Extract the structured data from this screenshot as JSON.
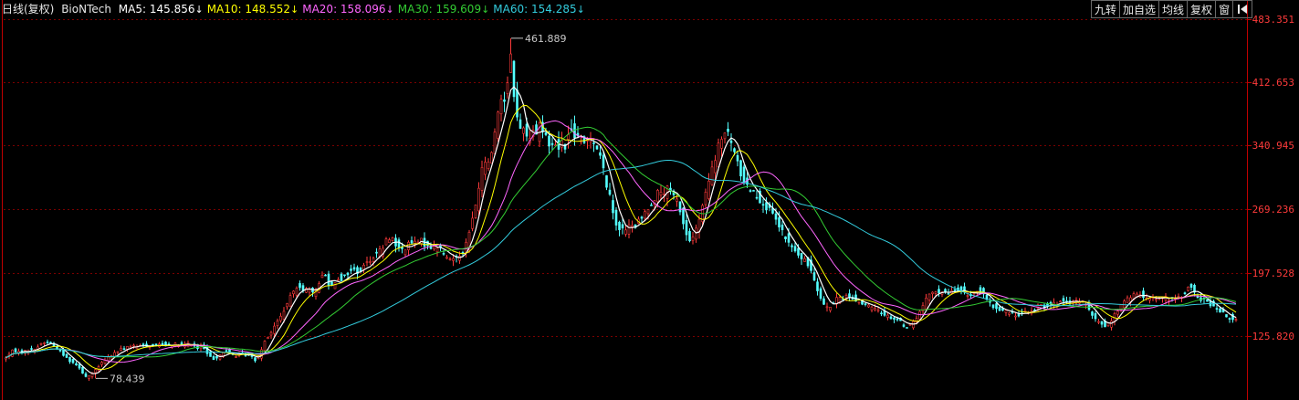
{
  "legend": {
    "title": "日线(复权)",
    "symbol": "BioNTech",
    "items": [
      {
        "label": "MA5:",
        "value": "145.856",
        "arrow": "↓",
        "color": "#ffffff"
      },
      {
        "label": "MA10:",
        "value": "148.552",
        "arrow": "↓",
        "color": "#ffff00"
      },
      {
        "label": "MA20:",
        "value": "158.096",
        "arrow": "↓",
        "color": "#ff66ff"
      },
      {
        "label": "MA30:",
        "value": "159.609",
        "arrow": "↓",
        "color": "#33cc33"
      },
      {
        "label": "MA60:",
        "value": "154.285",
        "arrow": "↓",
        "color": "#33ccdd"
      }
    ]
  },
  "toolbar": {
    "buttons": [
      "九转",
      "加自选",
      "均线",
      "复权",
      "窗"
    ],
    "icon": "collapse-left-icon"
  },
  "colors": {
    "up": "#ff3b3b",
    "down": "#54ffff",
    "grid": "#7a0000",
    "axis": "#c00000",
    "label": "#ff3b3b",
    "annotation": "#c8c8c8"
  },
  "chart_data": {
    "type": "candlestick",
    "y_ticks": [
      "483.351",
      "412.653",
      "340.945",
      "269.236",
      "197.528",
      "125.820"
    ],
    "ylim": [
      54.1,
      483.351
    ],
    "annotations": [
      {
        "text": "461.889",
        "value": 461.889,
        "type": "high"
      },
      {
        "text": "78.439",
        "value": 78.439,
        "type": "low"
      }
    ],
    "series": [
      {
        "name": "MA5",
        "color": "#ffffff",
        "width": 1.2
      },
      {
        "name": "MA10",
        "color": "#ffff00",
        "width": 1
      },
      {
        "name": "MA20",
        "color": "#ff66ff",
        "width": 1
      },
      {
        "name": "MA30",
        "color": "#33cc33",
        "width": 1
      },
      {
        "name": "MA60",
        "color": "#33ccdd",
        "width": 1
      }
    ],
    "close_path": [
      [
        0,
        98
      ],
      [
        7,
        103
      ],
      [
        14,
        110
      ],
      [
        22,
        108
      ],
      [
        30,
        110
      ],
      [
        38,
        112
      ],
      [
        45,
        118
      ],
      [
        52,
        120
      ],
      [
        58,
        115
      ],
      [
        63,
        112
      ],
      [
        68,
        106
      ],
      [
        74,
        100
      ],
      [
        80,
        96
      ],
      [
        86,
        92
      ],
      [
        90,
        85
      ],
      [
        94,
        80
      ],
      [
        98,
        82
      ],
      [
        103,
        86
      ],
      [
        110,
        95
      ],
      [
        118,
        102
      ],
      [
        126,
        108
      ],
      [
        134,
        112
      ],
      [
        142,
        115
      ],
      [
        150,
        114
      ],
      [
        158,
        116
      ],
      [
        166,
        115
      ],
      [
        174,
        117
      ],
      [
        182,
        116
      ],
      [
        190,
        117
      ],
      [
        198,
        115
      ],
      [
        206,
        118
      ],
      [
        212,
        115
      ],
      [
        216,
        112
      ],
      [
        220,
        116
      ],
      [
        224,
        110
      ],
      [
        228,
        104
      ],
      [
        232,
        100
      ],
      [
        236,
        102
      ],
      [
        240,
        105
      ],
      [
        246,
        110
      ],
      [
        252,
        106
      ],
      [
        258,
        104
      ],
      [
        264,
        106
      ],
      [
        270,
        105
      ],
      [
        276,
        102
      ],
      [
        281,
        98
      ],
      [
        285,
        110
      ],
      [
        290,
        122
      ],
      [
        296,
        130
      ],
      [
        302,
        140
      ],
      [
        308,
        150
      ],
      [
        314,
        162
      ],
      [
        320,
        175
      ],
      [
        326,
        185
      ],
      [
        332,
        178
      ],
      [
        337,
        180
      ],
      [
        341,
        172
      ],
      [
        346,
        180
      ],
      [
        350,
        190
      ],
      [
        355,
        198
      ],
      [
        358,
        188
      ],
      [
        362,
        182
      ],
      [
        366,
        188
      ],
      [
        370,
        192
      ],
      [
        374,
        190
      ],
      [
        378,
        195
      ],
      [
        382,
        198
      ],
      [
        386,
        202
      ],
      [
        390,
        198
      ],
      [
        394,
        200
      ],
      [
        398,
        205
      ],
      [
        402,
        210
      ],
      [
        406,
        213
      ],
      [
        410,
        218
      ],
      [
        414,
        220
      ],
      [
        418,
        225
      ],
      [
        422,
        232
      ],
      [
        426,
        238
      ],
      [
        430,
        235
      ],
      [
        434,
        228
      ],
      [
        438,
        222
      ],
      [
        442,
        225
      ],
      [
        446,
        228
      ],
      [
        450,
        232
      ],
      [
        455,
        230
      ],
      [
        460,
        234
      ],
      [
        465,
        230
      ],
      [
        470,
        228
      ],
      [
        475,
        225
      ],
      [
        480,
        228
      ],
      [
        485,
        220
      ],
      [
        490,
        212
      ],
      [
        495,
        214
      ],
      [
        500,
        216
      ],
      [
        505,
        220
      ],
      [
        510,
        230
      ],
      [
        514,
        245
      ],
      [
        518,
        262
      ],
      [
        522,
        282
      ],
      [
        526,
        305
      ],
      [
        530,
        325
      ],
      [
        534,
        318
      ],
      [
        538,
        335
      ],
      [
        542,
        360
      ],
      [
        546,
        385
      ],
      [
        550,
        400
      ],
      [
        553,
        390
      ],
      [
        556,
        420
      ],
      [
        558,
        455
      ],
      [
        560,
        430
      ],
      [
        563,
        395
      ],
      [
        566,
        370
      ],
      [
        569,
        358
      ],
      [
        572,
        372
      ],
      [
        575,
        352
      ],
      [
        578,
        345
      ],
      [
        581,
        358
      ],
      [
        584,
        362
      ],
      [
        587,
        355
      ],
      [
        590,
        368
      ],
      [
        593,
        360
      ],
      [
        596,
        352
      ],
      [
        599,
        348
      ],
      [
        602,
        340
      ],
      [
        606,
        345
      ],
      [
        610,
        338
      ],
      [
        614,
        346
      ],
      [
        618,
        340
      ],
      [
        622,
        352
      ],
      [
        626,
        358
      ],
      [
        630,
        352
      ],
      [
        634,
        346
      ],
      [
        638,
        340
      ],
      [
        642,
        348
      ],
      [
        646,
        352
      ],
      [
        650,
        345
      ],
      [
        654,
        338
      ],
      [
        658,
        325
      ],
      [
        662,
        305
      ],
      [
        666,
        290
      ],
      [
        670,
        270
      ],
      [
        674,
        255
      ],
      [
        678,
        248
      ],
      [
        682,
        245
      ],
      [
        686,
        248
      ],
      [
        690,
        250
      ],
      [
        694,
        248
      ],
      [
        698,
        254
      ],
      [
        702,
        258
      ],
      [
        706,
        265
      ],
      [
        710,
        272
      ],
      [
        714,
        278
      ],
      [
        718,
        284
      ],
      [
        722,
        290
      ],
      [
        726,
        286
      ],
      [
        730,
        292
      ],
      [
        734,
        288
      ],
      [
        738,
        282
      ],
      [
        742,
        278
      ],
      [
        746,
        262
      ],
      [
        750,
        245
      ],
      [
        754,
        232
      ],
      [
        758,
        238
      ],
      [
        762,
        245
      ],
      [
        766,
        260
      ],
      [
        770,
        275
      ],
      [
        774,
        292
      ],
      [
        778,
        310
      ],
      [
        782,
        320
      ],
      [
        786,
        338
      ],
      [
        790,
        350
      ],
      [
        794,
        355
      ],
      [
        798,
        352
      ],
      [
        802,
        340
      ],
      [
        806,
        325
      ],
      [
        810,
        312
      ],
      [
        814,
        302
      ],
      [
        818,
        296
      ],
      [
        822,
        292
      ],
      [
        826,
        288
      ],
      [
        830,
        282
      ],
      [
        834,
        278
      ],
      [
        838,
        272
      ],
      [
        842,
        268
      ],
      [
        846,
        262
      ],
      [
        850,
        255
      ],
      [
        854,
        248
      ],
      [
        858,
        240
      ],
      [
        862,
        232
      ],
      [
        866,
        228
      ],
      [
        870,
        222
      ],
      [
        874,
        218
      ],
      [
        878,
        212
      ],
      [
        882,
        210
      ],
      [
        886,
        205
      ],
      [
        890,
        196
      ],
      [
        894,
        182
      ],
      [
        898,
        172
      ],
      [
        902,
        162
      ],
      [
        906,
        158
      ],
      [
        910,
        160
      ],
      [
        914,
        165
      ],
      [
        918,
        170
      ],
      [
        922,
        168
      ],
      [
        926,
        172
      ],
      [
        930,
        170
      ],
      [
        934,
        168
      ],
      [
        938,
        166
      ],
      [
        942,
        164
      ],
      [
        946,
        162
      ],
      [
        950,
        160
      ],
      [
        954,
        158
      ],
      [
        958,
        156
      ],
      [
        962,
        155
      ],
      [
        966,
        152
      ],
      [
        970,
        150
      ],
      [
        974,
        148
      ],
      [
        978,
        146
      ],
      [
        982,
        145
      ],
      [
        986,
        142
      ],
      [
        990,
        138
      ],
      [
        994,
        136
      ],
      [
        998,
        140
      ],
      [
        1002,
        145
      ],
      [
        1006,
        150
      ],
      [
        1010,
        160
      ],
      [
        1014,
        168
      ],
      [
        1018,
        172
      ],
      [
        1022,
        175
      ],
      [
        1026,
        176
      ],
      [
        1030,
        178
      ],
      [
        1034,
        175
      ],
      [
        1038,
        174
      ],
      [
        1042,
        176
      ],
      [
        1046,
        178
      ],
      [
        1050,
        180
      ],
      [
        1054,
        176
      ],
      [
        1058,
        174
      ],
      [
        1062,
        172
      ],
      [
        1066,
        175
      ],
      [
        1070,
        178
      ],
      [
        1074,
        176
      ],
      [
        1078,
        170
      ],
      [
        1082,
        165
      ],
      [
        1086,
        160
      ],
      [
        1090,
        158
      ],
      [
        1094,
        156
      ],
      [
        1098,
        155
      ],
      [
        1102,
        154
      ],
      [
        1106,
        152
      ],
      [
        1110,
        150
      ],
      [
        1114,
        150
      ],
      [
        1118,
        152
      ],
      [
        1122,
        154
      ],
      [
        1126,
        152
      ],
      [
        1130,
        154
      ],
      [
        1134,
        158
      ],
      [
        1138,
        162
      ],
      [
        1142,
        160
      ],
      [
        1146,
        162
      ],
      [
        1150,
        164
      ],
      [
        1154,
        162
      ],
      [
        1158,
        163
      ],
      [
        1162,
        165
      ],
      [
        1166,
        164
      ],
      [
        1170,
        162
      ],
      [
        1174,
        164
      ],
      [
        1178,
        165
      ],
      [
        1182,
        166
      ],
      [
        1186,
        164
      ],
      [
        1190,
        160
      ],
      [
        1194,
        152
      ],
      [
        1198,
        146
      ],
      [
        1202,
        142
      ],
      [
        1206,
        140
      ],
      [
        1210,
        138
      ],
      [
        1214,
        140
      ],
      [
        1218,
        146
      ],
      [
        1222,
        152
      ],
      [
        1226,
        158
      ],
      [
        1230,
        164
      ],
      [
        1234,
        168
      ],
      [
        1238,
        170
      ],
      [
        1242,
        172
      ],
      [
        1246,
        174
      ],
      [
        1250,
        172
      ],
      [
        1254,
        170
      ],
      [
        1258,
        171
      ],
      [
        1262,
        170
      ],
      [
        1266,
        168
      ],
      [
        1270,
        169
      ],
      [
        1274,
        170
      ],
      [
        1278,
        168
      ],
      [
        1282,
        166
      ],
      [
        1286,
        168
      ],
      [
        1290,
        170
      ],
      [
        1294,
        172
      ],
      [
        1298,
        176
      ],
      [
        1302,
        182
      ],
      [
        1306,
        178
      ],
      [
        1310,
        172
      ],
      [
        1314,
        168
      ],
      [
        1318,
        166
      ],
      [
        1322,
        165
      ],
      [
        1326,
        162
      ],
      [
        1330,
        158
      ],
      [
        1334,
        154
      ],
      [
        1338,
        152
      ],
      [
        1342,
        150
      ],
      [
        1346,
        147
      ],
      [
        1350,
        145
      ],
      [
        1354,
        144
      ]
    ]
  }
}
